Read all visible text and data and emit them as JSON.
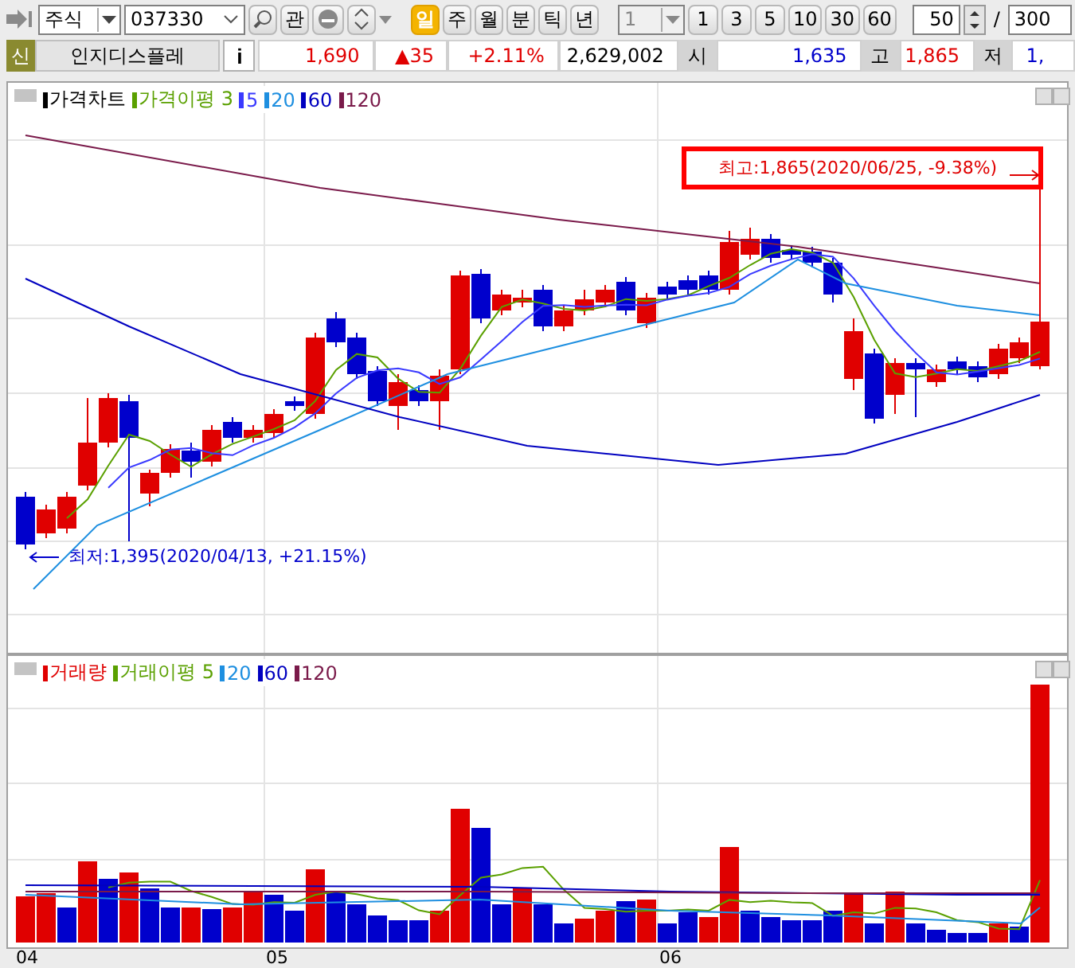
{
  "toolbar": {
    "market_select": "주식",
    "code_field": "037330",
    "watch_button": "관",
    "period_tabs": [
      {
        "label": "일",
        "selected": true
      },
      {
        "label": "주",
        "selected": false
      },
      {
        "label": "월",
        "selected": false
      },
      {
        "label": "분",
        "selected": false
      },
      {
        "label": "틱",
        "selected": false
      },
      {
        "label": "년",
        "selected": false
      }
    ],
    "interval_select": "1",
    "interval_buttons": [
      "1",
      "3",
      "5",
      "10",
      "30",
      "60"
    ],
    "count_field": "50",
    "separator": "/",
    "total_field": "300"
  },
  "quote_bar": {
    "badge": "신",
    "name": "인지디스플레",
    "info_button": "i",
    "price": "1,690",
    "change": "▲35",
    "rate": "+2.11%",
    "volume": "2,629,002",
    "fields": [
      {
        "label": "시",
        "value": "1,635",
        "color": "#0000cc"
      },
      {
        "label": "고",
        "value": "1,865",
        "color": "#e00000"
      },
      {
        "label": "저",
        "value": "1,",
        "color": "#0000cc"
      }
    ]
  },
  "price_panel": {
    "legend": [
      {
        "label": "가격차트",
        "color": "#000000"
      },
      {
        "label": "가격이평 3",
        "color": "#5aa000"
      },
      {
        "label": "5",
        "color": "#3a3aff"
      },
      {
        "label": "20",
        "color": "#1e8fe0"
      },
      {
        "label": "60",
        "color": "#0000c0"
      },
      {
        "label": "120",
        "color": "#7a1a4a"
      }
    ],
    "high_label": "최고:1,865(2020/06/25, -9.38%)",
    "low_label": "최저:1,395(2020/04/13, +21.15%)"
  },
  "volume_panel": {
    "legend": [
      {
        "label": "거래량",
        "color": "#e00000"
      },
      {
        "label": "거래이평 5",
        "color": "#5aa000"
      },
      {
        "label": "20",
        "color": "#1e8fe0"
      },
      {
        "label": "60",
        "color": "#0000c0"
      },
      {
        "label": "120",
        "color": "#7a1a4a"
      }
    ]
  },
  "x_axis": [
    "04",
    "05",
    "06"
  ]
}
